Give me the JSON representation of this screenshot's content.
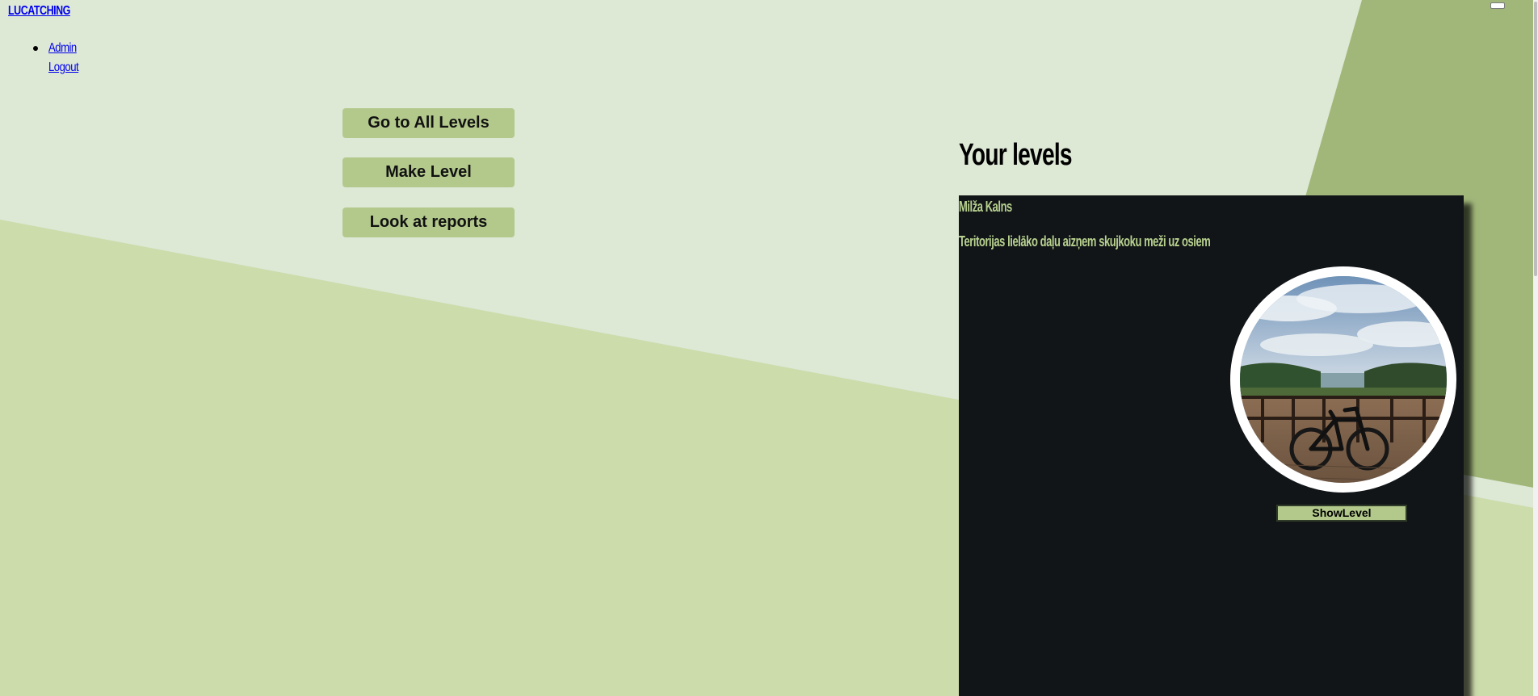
{
  "header": {
    "brand": "LUCATCHING"
  },
  "nav": {
    "items": [
      {
        "label": "Admin"
      },
      {
        "label": "Logout"
      }
    ]
  },
  "actions": {
    "all_levels": "Go to All Levels",
    "make_level": "Make Level",
    "reports": "Look at reports"
  },
  "levels_section": {
    "title": "Your levels",
    "cards": [
      {
        "name": "Milža Kalns",
        "description": "Teritorijas lielāko daļu aizņem skujkoku meži uz osiem",
        "image_alt": "lake viewpoint with bicycle",
        "button": "ShowLevel"
      }
    ]
  },
  "colors": {
    "background_light": "#dde8d5",
    "background_green": "#cddcab",
    "background_dark": "#a1b77a",
    "button": "#b3c98c",
    "card": "#111518",
    "accent_text": "#b8d18f"
  },
  "icons": {
    "corner_toggle": "window-toggle-icon"
  }
}
